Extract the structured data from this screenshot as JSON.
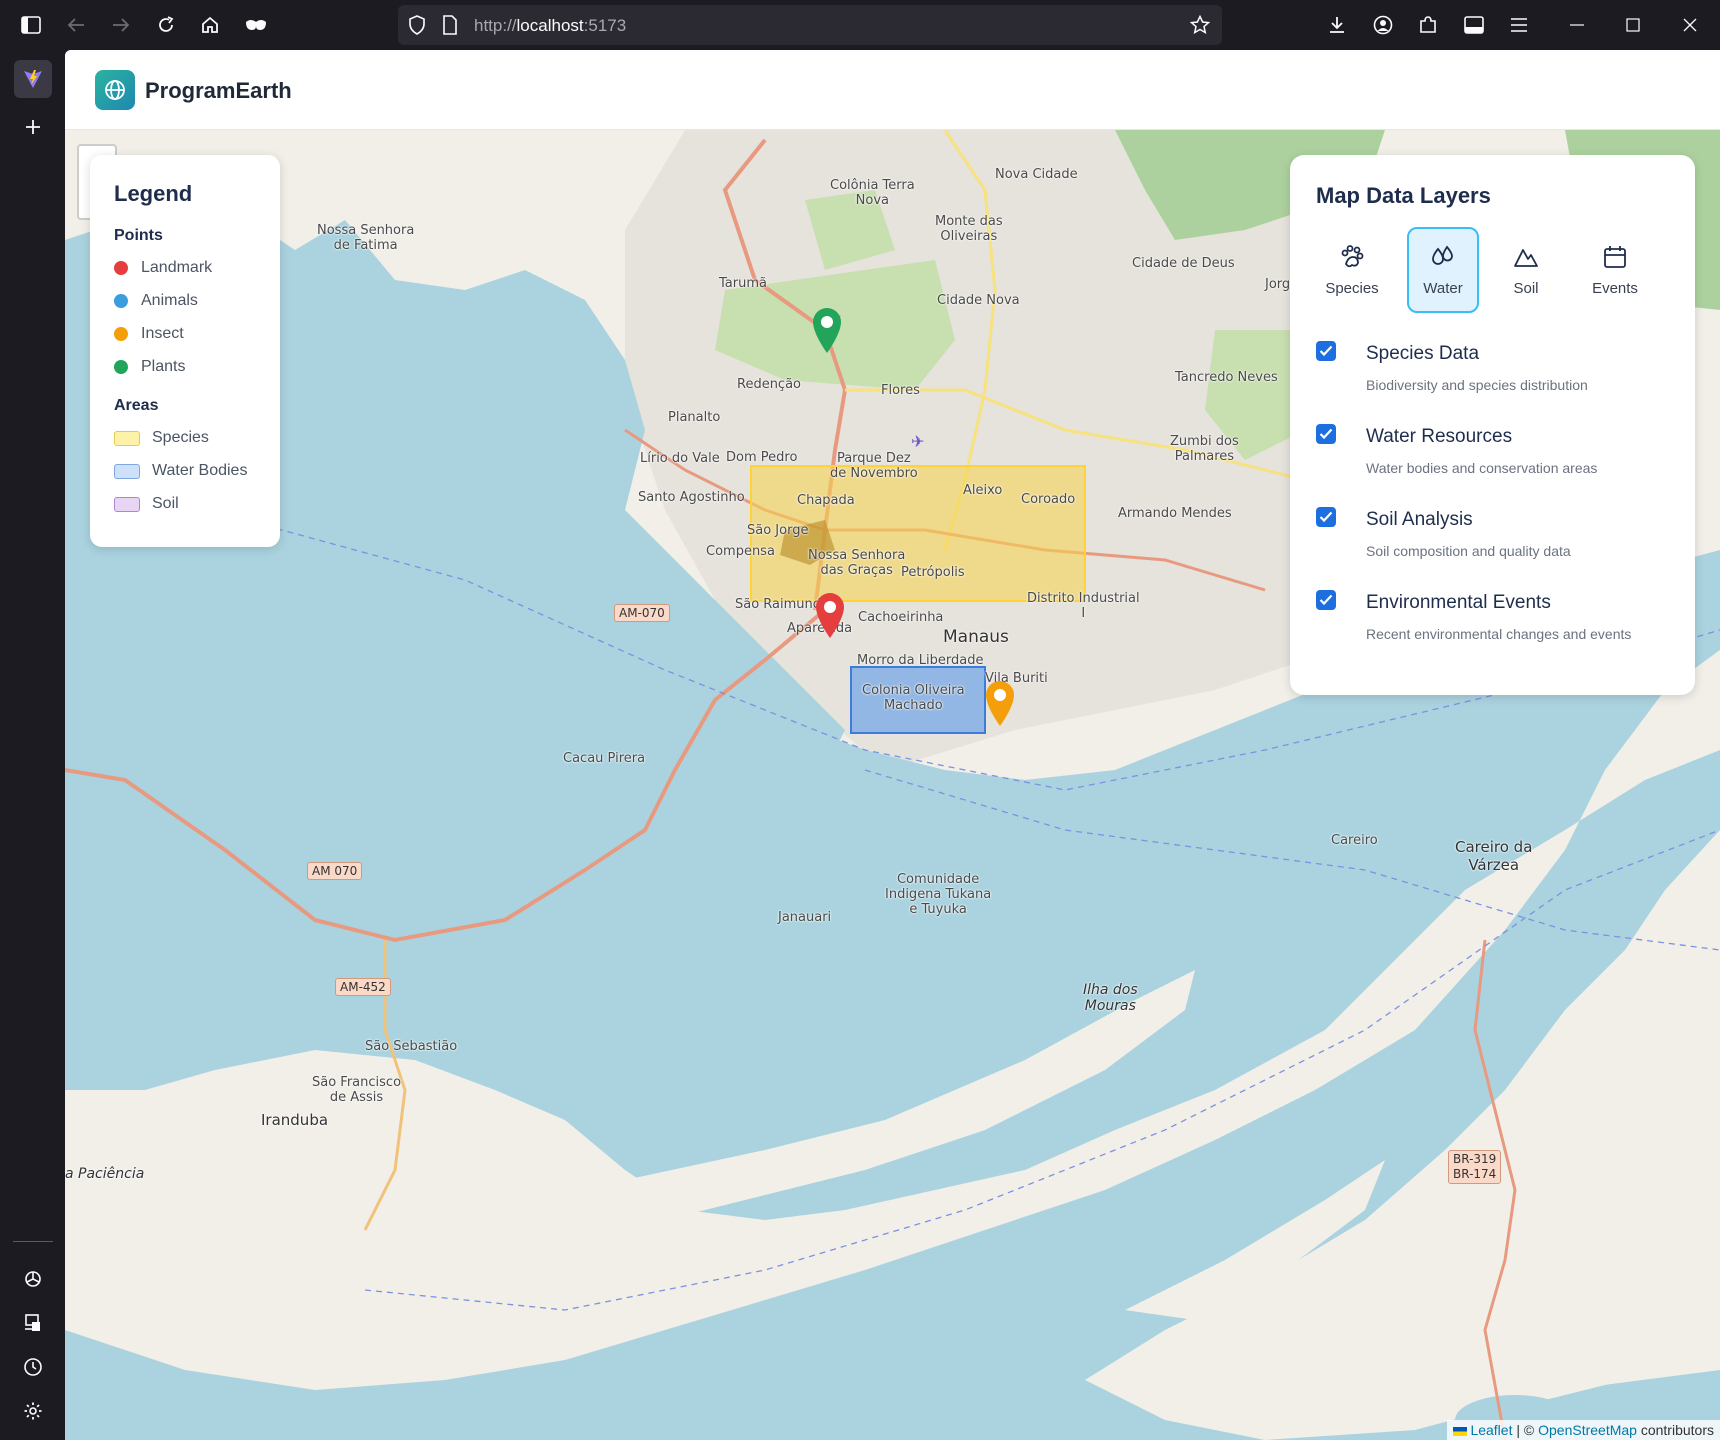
{
  "browser": {
    "url_prefix": "http://",
    "url_host": "localhost",
    "url_port": ":5173"
  },
  "app": {
    "title": "ProgramEarth"
  },
  "legend": {
    "title": "Legend",
    "points_heading": "Points",
    "points": [
      {
        "label": "Landmark",
        "color": "#e53e3e"
      },
      {
        "label": "Animals",
        "color": "#3b9ddd"
      },
      {
        "label": "Insect",
        "color": "#f59e0b"
      },
      {
        "label": "Plants",
        "color": "#22a55a"
      }
    ],
    "areas_heading": "Areas",
    "areas": [
      {
        "label": "Species",
        "fill": "#fdf3a8",
        "border": "#e9c84a"
      },
      {
        "label": "Water Bodies",
        "fill": "#cfe0fb",
        "border": "#7ea6e0"
      },
      {
        "label": "Soil",
        "fill": "#e8d4f3",
        "border": "#b583cf"
      }
    ]
  },
  "layers_panel": {
    "title": "Map Data Layers",
    "tabs": [
      {
        "label": "Species",
        "icon": "paw-icon"
      },
      {
        "label": "Water",
        "icon": "droplets-icon",
        "active": true
      },
      {
        "label": "Soil",
        "icon": "mountain-icon"
      },
      {
        "label": "Events",
        "icon": "calendar-icon"
      }
    ],
    "items": [
      {
        "name": "Species Data",
        "desc": "Biodiversity and species distribution",
        "checked": true
      },
      {
        "name": "Water Resources",
        "desc": "Water bodies and conservation areas",
        "checked": true
      },
      {
        "name": "Soil Analysis",
        "desc": "Soil composition and quality data",
        "checked": true
      },
      {
        "name": "Environmental Events",
        "desc": "Recent environmental changes and events",
        "checked": true
      }
    ]
  },
  "map": {
    "labels": {
      "nossa_senhora_fatima": "Nossa Senhora\nde Fatima",
      "colonia_terra_nova": "Colônia Terra\nNova",
      "nova_cidade": "Nova Cidade",
      "monte_oliveiras": "Monte das\nOliveiras",
      "cidade_de_deus": "Cidade de Deus",
      "jorge_teixeira": "Jorge Teixe",
      "taruma": "Tarumã",
      "cidade_nova": "Cidade Nova",
      "redencao": "Redenção",
      "flores": "Flores",
      "tancredo_neves": "Tancredo Neves",
      "planalto": "Planalto",
      "zumbi": "Zumbi dos\nPalmares",
      "lirio": "Lírio do Vale",
      "dom_pedro": "Dom Pedro",
      "parque_dez": "Parque Dez\nde Novembro",
      "santo_agostinho": "Santo Agostinho",
      "chapada": "Chapada",
      "aleixo": "Aleixo",
      "coroado": "Coroado",
      "armando": "Armando Mendes",
      "sao_jorge": "São Jorge",
      "compensa": "Compensa",
      "nossa_senhora_gracas": "Nossa Senhora\ndas Graças",
      "petropolis": "Petrópolis",
      "distrito": "Distrito Industrial\nI",
      "sao_raimundo": "São Raimundo",
      "aparecida": "Aparecida",
      "cachoeirinha": "Cachoeirinha",
      "manaus": "Manaus",
      "morro": "Morro da Liberdade",
      "vila_buriti": "Vila Buriti",
      "colonia_oliveira": "Colonia Oliveira\nMachado",
      "cacau_pirera": "Cacau Pirera",
      "careiro": "Careiro",
      "careiro_varzea": "Careiro da\nVárzea",
      "comunidade": "Comunidade\nIndigena Tukana\ne Tuyuka",
      "janauari": "Janauari",
      "ilha_mouras": "Ilha dos\nMouras",
      "sao_sebastiao": "São Sebastião",
      "sao_francisco": "São Francisco\nde Assis",
      "iranduba": "Iranduba",
      "paciencia": "a Paciência"
    },
    "shields": {
      "am070_a": "AM-070",
      "am070_b": "AM 070",
      "am452": "AM-452",
      "br319": "BR-319\nBR-174"
    },
    "markers": [
      {
        "type": "Plants",
        "color": "#22a55a"
      },
      {
        "type": "Landmark",
        "color": "#e53e3e"
      },
      {
        "type": "Insect",
        "color": "#f59e0b"
      }
    ]
  },
  "attribution": {
    "leaflet": "Leaflet",
    "separator": " | © ",
    "osm": "OpenStreetMap",
    "suffix": " contributors"
  }
}
